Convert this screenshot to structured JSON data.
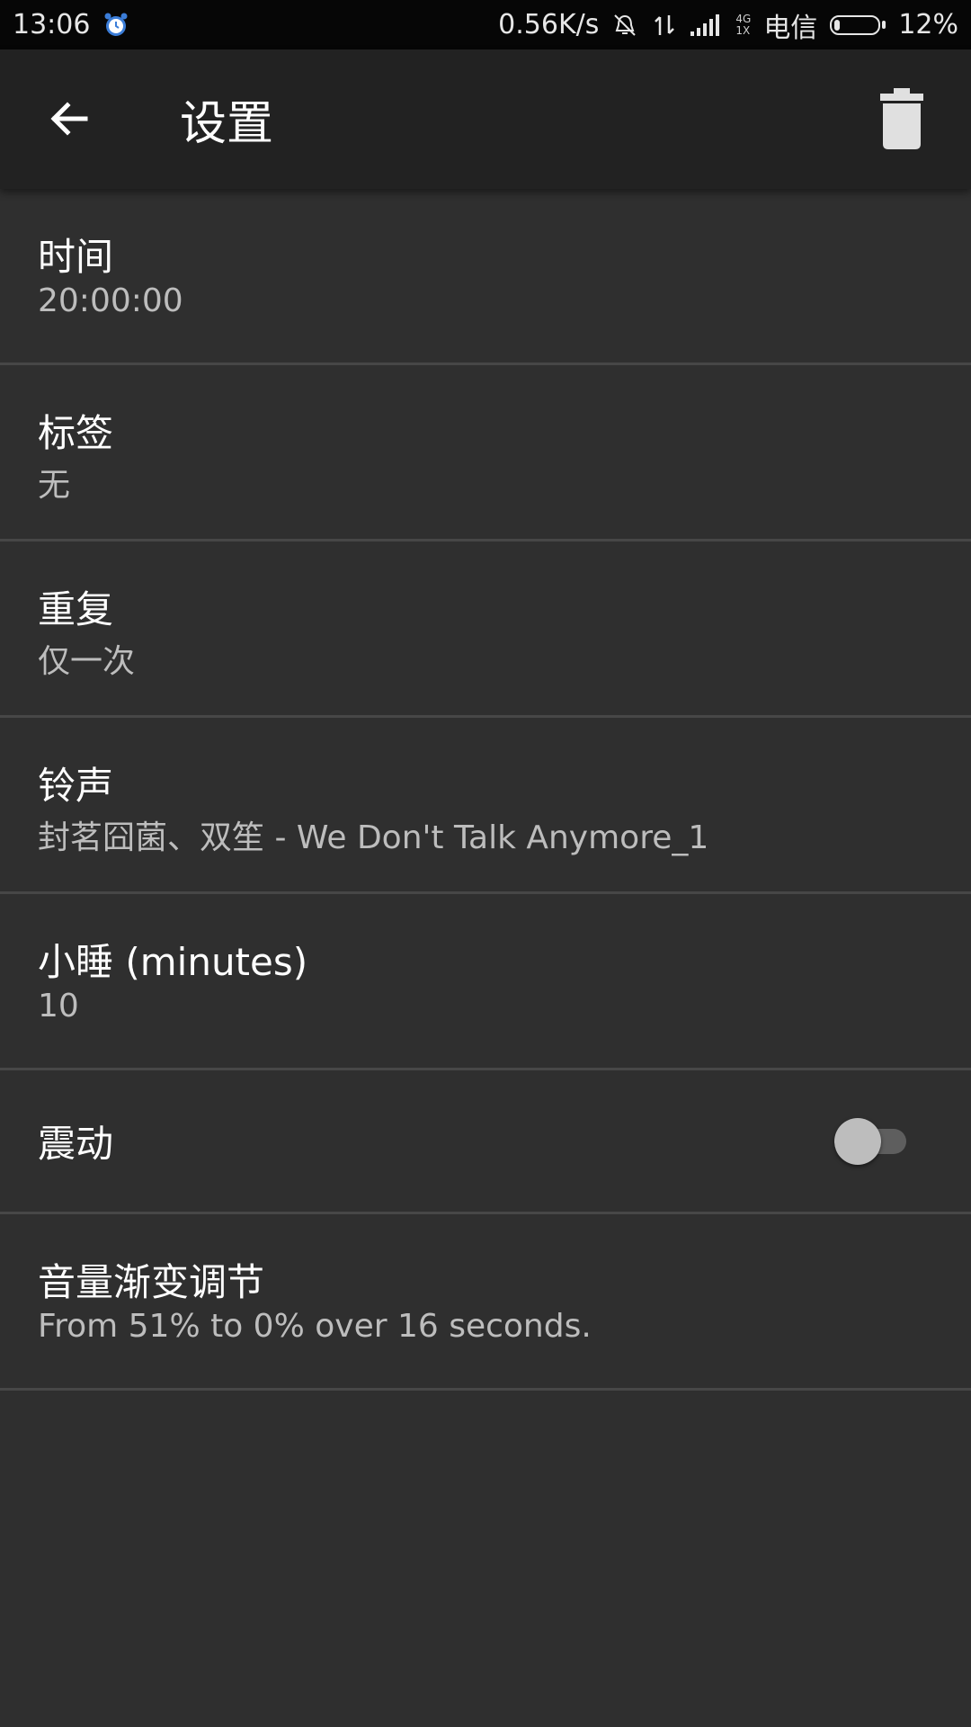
{
  "status_bar": {
    "time": "13:06",
    "net_speed": "0.56K/s",
    "net_type_top": "4G",
    "net_type_bottom": "1X",
    "carrier": "电信",
    "battery_percent_text": "12%",
    "battery_level": 0.12
  },
  "toolbar": {
    "title": "设置",
    "back_icon": "arrow-left-icon",
    "delete_icon": "trash-icon"
  },
  "settings": {
    "time": {
      "title": "时间",
      "value": "20:00:00"
    },
    "label": {
      "title": "标签",
      "value": "无"
    },
    "repeat": {
      "title": "重复",
      "value": "仅一次"
    },
    "ringtone": {
      "title": "铃声",
      "value": "封茗囧菌、双笙 - We Don't Talk Anymore_1"
    },
    "snooze": {
      "title": "小睡 (minutes)",
      "value": "10"
    },
    "vibrate": {
      "title": "震动",
      "enabled": false
    },
    "volume_ramp": {
      "title": "音量渐变调节",
      "value": "From 51% to 0% over 16 seconds."
    }
  },
  "colors": {
    "background": "#2f2f2f",
    "toolbar": "#222222",
    "status_bar": "#060606",
    "divider": "#474747",
    "secondary_text": "#bdbdbd"
  }
}
